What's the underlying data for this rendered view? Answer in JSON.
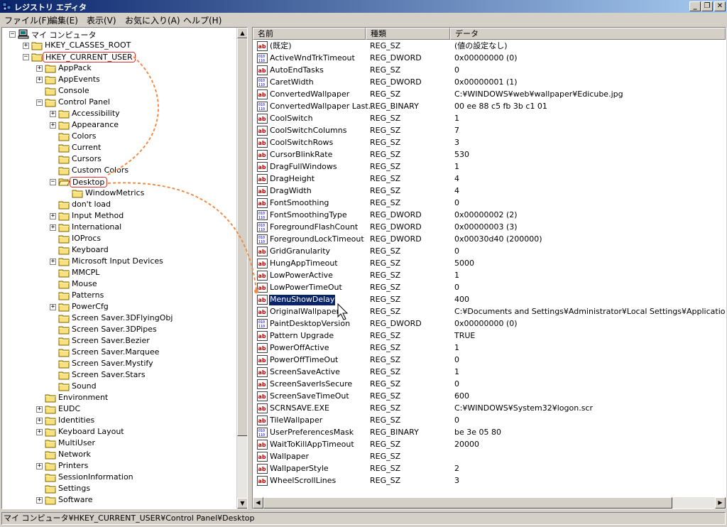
{
  "window": {
    "title": "レジストリ エディタ",
    "min_glyph": "_",
    "max_glyph": "❐",
    "close_glyph": "✕"
  },
  "menu": [
    "ファイル(F)",
    "編集(E)",
    "表示(V)",
    "お気に入り(A)",
    "ヘルプ(H)"
  ],
  "tree": [
    {
      "label": "マイ コンピュータ",
      "indent": 0,
      "exp": "−",
      "icon": "computer-icon"
    },
    {
      "label": "HKEY_CLASSES_ROOT",
      "indent": 1,
      "exp": "+",
      "icon": "folder-icon"
    },
    {
      "label": "HKEY_CURRENT_USER",
      "indent": 1,
      "exp": "−",
      "icon": "folder-icon",
      "highlighted": true
    },
    {
      "label": "AppPack",
      "indent": 2,
      "exp": "+",
      "icon": "folder-icon"
    },
    {
      "label": "AppEvents",
      "indent": 2,
      "exp": "+",
      "icon": "folder-icon"
    },
    {
      "label": "Console",
      "indent": 2,
      "exp": "",
      "icon": "folder-icon"
    },
    {
      "label": "Control Panel",
      "indent": 2,
      "exp": "−",
      "icon": "folder-icon"
    },
    {
      "label": "Accessibility",
      "indent": 3,
      "exp": "+",
      "icon": "folder-icon"
    },
    {
      "label": "Appearance",
      "indent": 3,
      "exp": "+",
      "icon": "folder-icon"
    },
    {
      "label": "Colors",
      "indent": 3,
      "exp": "",
      "icon": "folder-icon"
    },
    {
      "label": "Current",
      "indent": 3,
      "exp": "",
      "icon": "folder-icon"
    },
    {
      "label": "Cursors",
      "indent": 3,
      "exp": "",
      "icon": "folder-icon"
    },
    {
      "label": "Custom Colors",
      "indent": 3,
      "exp": "",
      "icon": "folder-icon"
    },
    {
      "label": "Desktop",
      "indent": 3,
      "exp": "−",
      "icon": "open-folder-icon",
      "highlighted": true
    },
    {
      "label": "WindowMetrics",
      "indent": 4,
      "exp": "",
      "icon": "folder-icon"
    },
    {
      "label": "don't load",
      "indent": 3,
      "exp": "",
      "icon": "folder-icon"
    },
    {
      "label": "Input Method",
      "indent": 3,
      "exp": "+",
      "icon": "folder-icon"
    },
    {
      "label": "International",
      "indent": 3,
      "exp": "+",
      "icon": "folder-icon"
    },
    {
      "label": "IOProcs",
      "indent": 3,
      "exp": "",
      "icon": "folder-icon"
    },
    {
      "label": "Keyboard",
      "indent": 3,
      "exp": "",
      "icon": "folder-icon"
    },
    {
      "label": "Microsoft Input Devices",
      "indent": 3,
      "exp": "+",
      "icon": "folder-icon"
    },
    {
      "label": "MMCPL",
      "indent": 3,
      "exp": "",
      "icon": "folder-icon"
    },
    {
      "label": "Mouse",
      "indent": 3,
      "exp": "",
      "icon": "folder-icon"
    },
    {
      "label": "Patterns",
      "indent": 3,
      "exp": "",
      "icon": "folder-icon"
    },
    {
      "label": "PowerCfg",
      "indent": 3,
      "exp": "+",
      "icon": "folder-icon"
    },
    {
      "label": "Screen Saver.3DFlyingObj",
      "indent": 3,
      "exp": "",
      "icon": "folder-icon"
    },
    {
      "label": "Screen Saver.3DPipes",
      "indent": 3,
      "exp": "",
      "icon": "folder-icon"
    },
    {
      "label": "Screen Saver.Bezier",
      "indent": 3,
      "exp": "",
      "icon": "folder-icon"
    },
    {
      "label": "Screen Saver.Marquee",
      "indent": 3,
      "exp": "",
      "icon": "folder-icon"
    },
    {
      "label": "Screen Saver.Mystify",
      "indent": 3,
      "exp": "",
      "icon": "folder-icon"
    },
    {
      "label": "Screen Saver.Stars",
      "indent": 3,
      "exp": "",
      "icon": "folder-icon"
    },
    {
      "label": "Sound",
      "indent": 3,
      "exp": "",
      "icon": "folder-icon"
    },
    {
      "label": "Environment",
      "indent": 2,
      "exp": "",
      "icon": "folder-icon"
    },
    {
      "label": "EUDC",
      "indent": 2,
      "exp": "+",
      "icon": "folder-icon"
    },
    {
      "label": "Identities",
      "indent": 2,
      "exp": "+",
      "icon": "folder-icon"
    },
    {
      "label": "Keyboard Layout",
      "indent": 2,
      "exp": "+",
      "icon": "folder-icon"
    },
    {
      "label": "MultiUser",
      "indent": 2,
      "exp": "",
      "icon": "folder-icon"
    },
    {
      "label": "Network",
      "indent": 2,
      "exp": "",
      "icon": "folder-icon"
    },
    {
      "label": "Printers",
      "indent": 2,
      "exp": "+",
      "icon": "folder-icon"
    },
    {
      "label": "SessionInformation",
      "indent": 2,
      "exp": "",
      "icon": "folder-icon"
    },
    {
      "label": "Settings",
      "indent": 2,
      "exp": "",
      "icon": "folder-icon"
    },
    {
      "label": "Software",
      "indent": 2,
      "exp": "+",
      "icon": "folder-icon"
    }
  ],
  "list": {
    "columns": [
      "名前",
      "種類",
      "データ"
    ],
    "rows": [
      {
        "name": "(既定)",
        "type": "REG_SZ",
        "data": "(値の設定なし)",
        "icon": "string-value-icon"
      },
      {
        "name": "ActiveWndTrkTimeout",
        "type": "REG_DWORD",
        "data": "0x00000000 (0)",
        "icon": "binary-value-icon"
      },
      {
        "name": "AutoEndTasks",
        "type": "REG_SZ",
        "data": "0",
        "icon": "string-value-icon"
      },
      {
        "name": "CaretWidth",
        "type": "REG_DWORD",
        "data": "0x00000001 (1)",
        "icon": "binary-value-icon"
      },
      {
        "name": "ConvertedWallpaper",
        "type": "REG_SZ",
        "data": "C:¥WINDOWS¥web¥wallpaper¥Edicube.jpg",
        "icon": "string-value-icon"
      },
      {
        "name": "ConvertedWallpaper Last...",
        "type": "REG_BINARY",
        "data": "00 ee 88 c5 fb 3b c1 01",
        "icon": "binary-value-icon"
      },
      {
        "name": "CoolSwitch",
        "type": "REG_SZ",
        "data": "1",
        "icon": "string-value-icon"
      },
      {
        "name": "CoolSwitchColumns",
        "type": "REG_SZ",
        "data": "7",
        "icon": "string-value-icon"
      },
      {
        "name": "CoolSwitchRows",
        "type": "REG_SZ",
        "data": "3",
        "icon": "string-value-icon"
      },
      {
        "name": "CursorBlinkRate",
        "type": "REG_SZ",
        "data": "530",
        "icon": "string-value-icon"
      },
      {
        "name": "DragFullWindows",
        "type": "REG_SZ",
        "data": "1",
        "icon": "string-value-icon"
      },
      {
        "name": "DragHeight",
        "type": "REG_SZ",
        "data": "4",
        "icon": "string-value-icon"
      },
      {
        "name": "DragWidth",
        "type": "REG_SZ",
        "data": "4",
        "icon": "string-value-icon"
      },
      {
        "name": "FontSmoothing",
        "type": "REG_SZ",
        "data": "0",
        "icon": "string-value-icon"
      },
      {
        "name": "FontSmoothingType",
        "type": "REG_DWORD",
        "data": "0x00000002 (2)",
        "icon": "binary-value-icon"
      },
      {
        "name": "ForegroundFlashCount",
        "type": "REG_DWORD",
        "data": "0x00000003 (3)",
        "icon": "binary-value-icon"
      },
      {
        "name": "ForegroundLockTimeout",
        "type": "REG_DWORD",
        "data": "0x00030d40 (200000)",
        "icon": "binary-value-icon"
      },
      {
        "name": "GridGranularity",
        "type": "REG_SZ",
        "data": "0",
        "icon": "string-value-icon"
      },
      {
        "name": "HungAppTimeout",
        "type": "REG_SZ",
        "data": "5000",
        "icon": "string-value-icon"
      },
      {
        "name": "LowPowerActive",
        "type": "REG_SZ",
        "data": "1",
        "icon": "string-value-icon"
      },
      {
        "name": "LowPowerTimeOut",
        "type": "REG_SZ",
        "data": "0",
        "icon": "string-value-icon"
      },
      {
        "name": "MenuShowDelay",
        "type": "REG_SZ",
        "data": "400",
        "icon": "string-value-icon",
        "selected": true
      },
      {
        "name": "OriginalWallpaper",
        "type": "REG_SZ",
        "data": "C:¥Documents and Settings¥Administrator¥Local Settings¥Application Data",
        "icon": "string-value-icon"
      },
      {
        "name": "PaintDesktopVersion",
        "type": "REG_DWORD",
        "data": "0x00000000 (0)",
        "icon": "binary-value-icon"
      },
      {
        "name": "Pattern Upgrade",
        "type": "REG_SZ",
        "data": "TRUE",
        "icon": "string-value-icon"
      },
      {
        "name": "PowerOffActive",
        "type": "REG_SZ",
        "data": "1",
        "icon": "string-value-icon"
      },
      {
        "name": "PowerOffTimeOut",
        "type": "REG_SZ",
        "data": "0",
        "icon": "string-value-icon"
      },
      {
        "name": "ScreenSaveActive",
        "type": "REG_SZ",
        "data": "1",
        "icon": "string-value-icon"
      },
      {
        "name": "ScreenSaverIsSecure",
        "type": "REG_SZ",
        "data": "0",
        "icon": "string-value-icon"
      },
      {
        "name": "ScreenSaveTimeOut",
        "type": "REG_SZ",
        "data": "600",
        "icon": "string-value-icon"
      },
      {
        "name": "SCRNSAVE.EXE",
        "type": "REG_SZ",
        "data": "C:¥WINDOWS¥System32¥logon.scr",
        "icon": "string-value-icon"
      },
      {
        "name": "TileWallpaper",
        "type": "REG_SZ",
        "data": "0",
        "icon": "string-value-icon"
      },
      {
        "name": "UserPreferencesMask",
        "type": "REG_BINARY",
        "data": "be 3e 05 80",
        "icon": "binary-value-icon"
      },
      {
        "name": "WaitToKillAppTimeout",
        "type": "REG_SZ",
        "data": "20000",
        "icon": "string-value-icon"
      },
      {
        "name": "Wallpaper",
        "type": "REG_SZ",
        "data": "",
        "icon": "string-value-icon"
      },
      {
        "name": "WallpaperStyle",
        "type": "REG_SZ",
        "data": "2",
        "icon": "string-value-icon"
      },
      {
        "name": "WheelScrollLines",
        "type": "REG_SZ",
        "data": "3",
        "icon": "string-value-icon"
      }
    ]
  },
  "statusbar": {
    "path": "マイ コンピュータ¥HKEY_CURRENT_USER¥Control Panel¥Desktop"
  },
  "colors": {
    "title_start": "#0a246a",
    "title_end": "#a6caf0",
    "selection": "#0a246a",
    "annotation": "#f08c46",
    "highlight_box": "#e03030"
  }
}
